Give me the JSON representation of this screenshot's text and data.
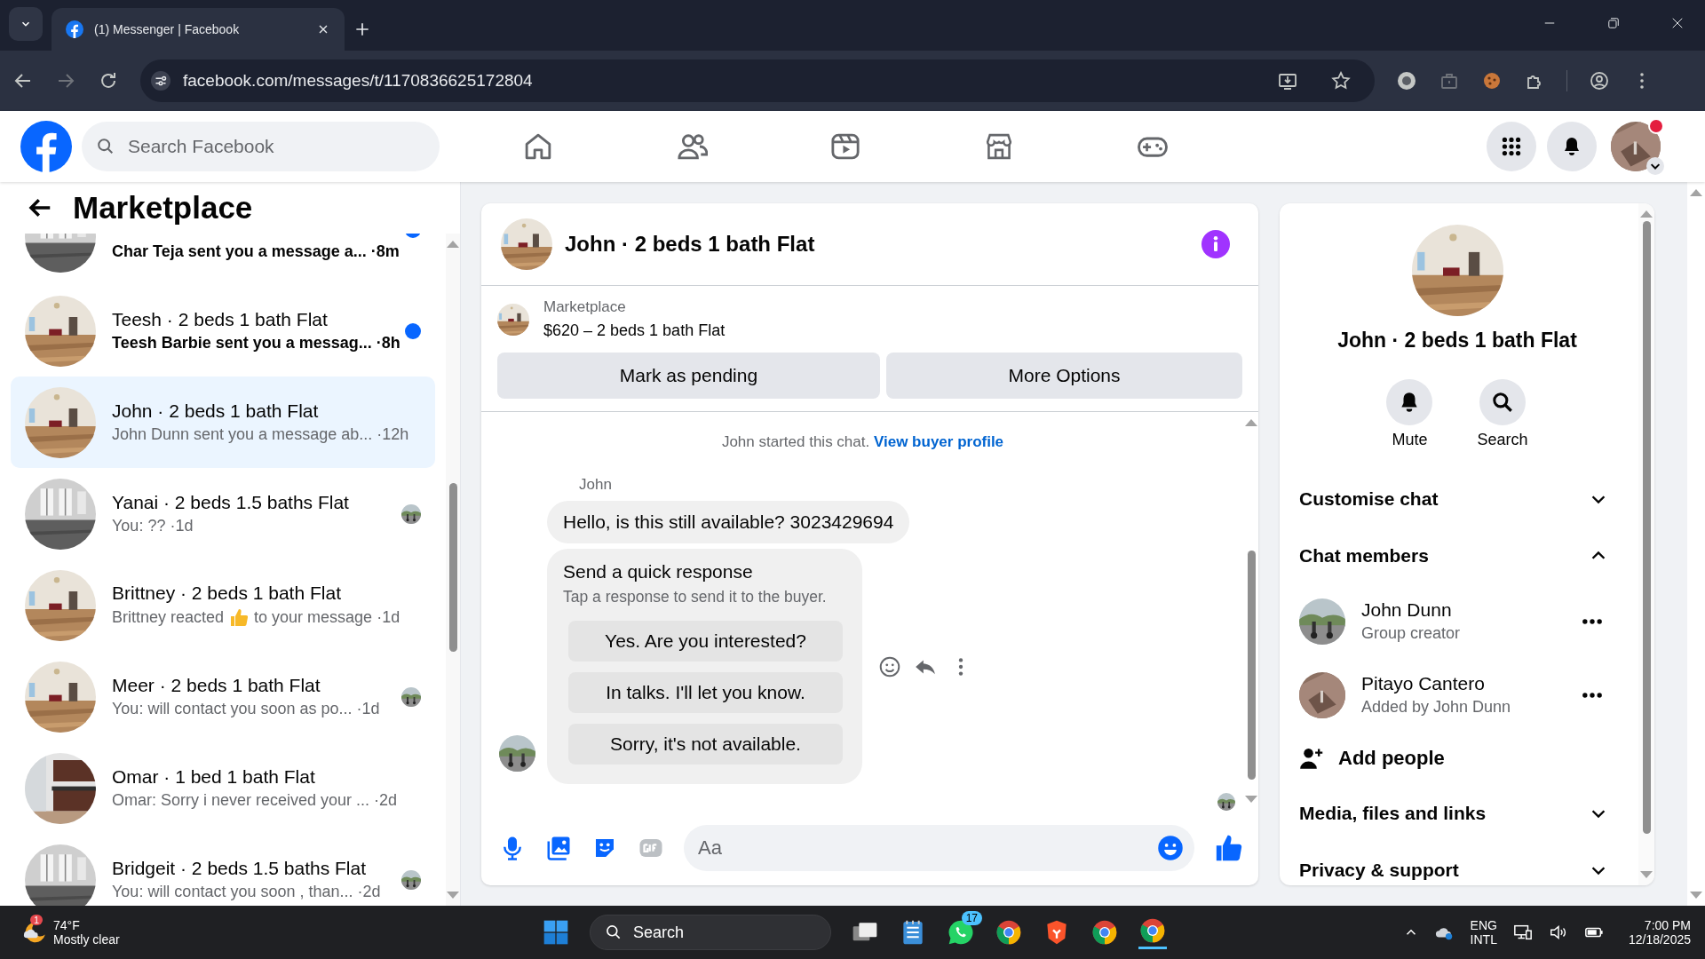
{
  "browser": {
    "tab_title": "(1) Messenger | Facebook",
    "url": "facebook.com/messages/t/1170836625172804"
  },
  "header": {
    "search_placeholder": "Search Facebook",
    "notification_dot": true
  },
  "sidebar": {
    "title": "Marketplace",
    "conversations": [
      {
        "preview": "Char Teja sent you a message a...",
        "time": "·8m",
        "unread": true,
        "seen": false,
        "selected": false
      },
      {
        "title": "Teesh · 2 beds 1 bath Flat",
        "preview": "Teesh Barbie sent you a messag...",
        "time": "·8h",
        "unread": true,
        "seen": false,
        "selected": false
      },
      {
        "title": "John · 2 beds 1 bath Flat",
        "preview": "John Dunn sent you a message ab...",
        "time": "·12h",
        "unread": false,
        "seen": false,
        "selected": true
      },
      {
        "title": "Yanai · 2 beds 1.5 baths Flat",
        "preview": "You: ??",
        "time": "·1d",
        "unread": false,
        "seen": true,
        "selected": false
      },
      {
        "title": "Brittney · 2 beds 1 bath Flat",
        "preview": "Brittney reacted",
        "preview_after": "to your message",
        "time": "·1d",
        "unread": false,
        "seen": false,
        "selected": false
      },
      {
        "title": "Meer · 2 beds 1 bath Flat",
        "preview": "You: will contact you soon as po...",
        "time": "·1d",
        "unread": false,
        "seen": true,
        "selected": false
      },
      {
        "title": "Omar · 1 bed 1 bath Flat",
        "preview": "Omar: Sorry i never received your ...",
        "time": "·2d",
        "unread": false,
        "seen": false,
        "selected": false
      },
      {
        "title": "Bridgeit · 2 beds 1.5 baths Flat",
        "preview": "You: will contact you soon , than...",
        "time": "·2d",
        "unread": false,
        "seen": true,
        "selected": false
      }
    ]
  },
  "chat": {
    "title": "John · 2 beds 1 bath Flat",
    "listing": {
      "label": "Marketplace",
      "price_title": "$620 – 2 beds 1 bath Flat"
    },
    "buttons": [
      "Mark as pending",
      "More Options"
    ],
    "note": "John started this chat.",
    "note_link": "View buyer profile",
    "sender": "John",
    "message": "Hello, is this still available? 3023429694",
    "quick_response": {
      "title": "Send a quick response",
      "subtitle": "Tap a response to send it to the buyer.",
      "options": [
        "Yes. Are you interested?",
        "In talks. I'll let you know.",
        "Sorry, it's not available."
      ]
    },
    "composer_placeholder": "Aa"
  },
  "details": {
    "title": "John · 2 beds 1 bath Flat",
    "actions": [
      {
        "kind": "mute",
        "label": "Mute"
      },
      {
        "kind": "search",
        "label": "Search"
      }
    ],
    "sections": [
      {
        "label": "Customise chat",
        "expanded": false
      },
      {
        "label": "Chat members",
        "expanded": true,
        "members": [
          {
            "name": "John Dunn",
            "role": "Group creator"
          },
          {
            "name": "Pitayo Cantero",
            "role": "Added by John Dunn"
          }
        ],
        "add_label": "Add people"
      },
      {
        "label": "Media, files and links",
        "expanded": false
      },
      {
        "label": "Privacy & support",
        "expanded": false
      }
    ]
  },
  "taskbar": {
    "temperature": "74°F",
    "weather": "Mostly clear",
    "weather_badge": "1",
    "search": "Search",
    "whatsapp_badge": "17",
    "lang": "ENG",
    "layout": "INTL",
    "time": "7:00 PM",
    "date": "12/18/2025"
  }
}
